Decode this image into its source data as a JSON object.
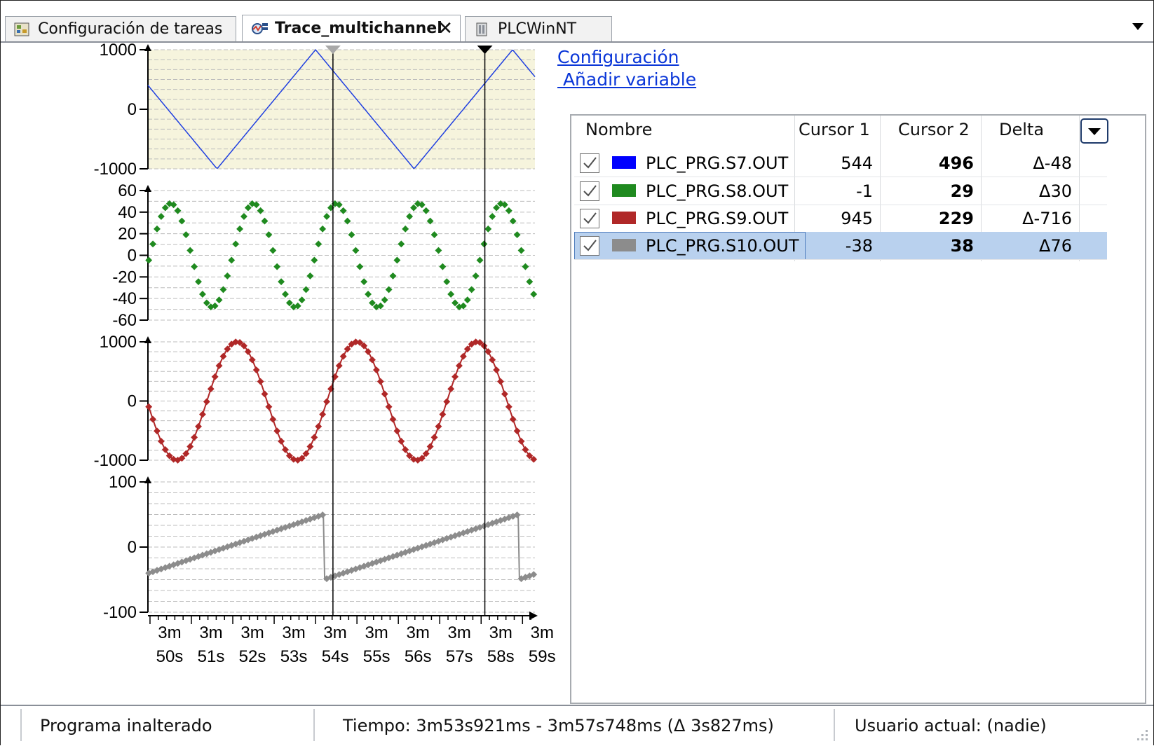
{
  "tabs": [
    {
      "label": "Configuración de tareas",
      "icon": "task-config-icon",
      "active": false
    },
    {
      "label": "Trace_multichannel",
      "icon": "trace-icon",
      "active": true,
      "close": "✕"
    },
    {
      "label": "PLCWinNT",
      "icon": "plc-device-icon",
      "active": false
    }
  ],
  "links": {
    "config": "Configuración",
    "add_variable": " Añadir variable"
  },
  "table": {
    "headers": [
      "Nombre",
      "Cursor 1",
      "Cursor 2",
      "Delta"
    ],
    "rows": [
      {
        "name": "PLC_PRG.S7.OUT",
        "color": "#0000ff",
        "cursor1": "544",
        "cursor2": "496",
        "delta": "Δ-48",
        "checked": true,
        "selected": false
      },
      {
        "name": "PLC_PRG.S8.OUT",
        "color": "#1f8a1f",
        "cursor1": "-1",
        "cursor2": "29",
        "delta": "Δ30",
        "checked": true,
        "selected": false
      },
      {
        "name": "PLC_PRG.S9.OUT",
        "color": "#b02828",
        "cursor1": "945",
        "cursor2": "229",
        "delta": "Δ-716",
        "checked": true,
        "selected": false
      },
      {
        "name": "PLC_PRG.S10.OUT",
        "color": "#8c8c8c",
        "cursor1": "-38",
        "cursor2": "38",
        "delta": "Δ76",
        "checked": true,
        "selected": true
      }
    ]
  },
  "status": {
    "program": "Programa inalterado",
    "time": "Tiempo: 3m53s921ms - 3m57s748ms (Δ 3s827ms)",
    "user": "Usuario actual: (nadie)"
  },
  "chart_data": {
    "type": "line",
    "x_ticks": [
      {
        "top": "3m",
        "bottom": "50s"
      },
      {
        "top": "3m",
        "bottom": "51s"
      },
      {
        "top": "3m",
        "bottom": "52s"
      },
      {
        "top": "3m",
        "bottom": "53s"
      },
      {
        "top": "3m",
        "bottom": "54s"
      },
      {
        "top": "3m",
        "bottom": "55s"
      },
      {
        "top": "3m",
        "bottom": "56s"
      },
      {
        "top": "3m",
        "bottom": "57s"
      },
      {
        "top": "3m",
        "bottom": "58s"
      },
      {
        "top": "3m",
        "bottom": "59s"
      }
    ],
    "x_range_s": [
      229.95,
      239.3
    ],
    "cursor1_s": 234.42,
    "cursor2_s": 238.09,
    "panels": [
      {
        "series": "PLC_PRG.S7.OUT",
        "color": "#1f3fe0",
        "style": "line",
        "ylim": [
          -1000,
          1000
        ],
        "yticks": [
          "1000",
          "0",
          "-1000"
        ],
        "yvals": [
          1000,
          0,
          -1000
        ],
        "background": "#f6f4dd",
        "waveform": "triangle",
        "period_s": 4.76,
        "peak_s": 234.0
      },
      {
        "series": "PLC_PRG.S8.OUT",
        "color": "#1f8a1f",
        "style": "points",
        "ylim": [
          -60,
          60
        ],
        "yticks": [
          "60",
          "40",
          "20",
          "0",
          "-20",
          "-40",
          "-60"
        ],
        "yvals": [
          60,
          40,
          20,
          0,
          -20,
          -40,
          -60
        ],
        "background": "#ffffff",
        "waveform": "sine",
        "amplitude": 48,
        "period_s": 2.0,
        "zero_s": 230.0
      },
      {
        "series": "PLC_PRG.S9.OUT",
        "color": "#b02828",
        "style": "line+points",
        "ylim": [
          -1000,
          1000
        ],
        "yticks": [
          "1000",
          "0",
          "-1000"
        ],
        "yvals": [
          1000,
          0,
          -1000
        ],
        "background": "#ffffff",
        "waveform": "sine",
        "amplitude": 1000,
        "period_s": 2.9,
        "peak_s": 232.1
      },
      {
        "series": "PLC_PRG.S10.OUT",
        "color": "#8c8c8c",
        "style": "line+points",
        "ylim": [
          -100,
          100
        ],
        "yticks": [
          "100",
          "0",
          "-100"
        ],
        "yvals": [
          100,
          0,
          -100
        ],
        "background": "#ffffff",
        "waveform": "sawtooth",
        "min": -50,
        "max": 50,
        "period_s": 4.7,
        "reset_s": 234.2
      }
    ]
  }
}
